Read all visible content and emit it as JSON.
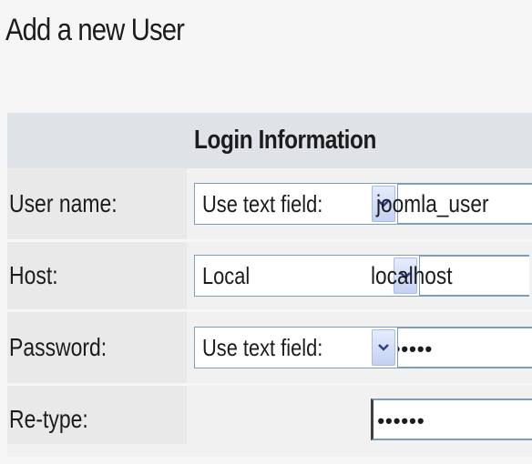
{
  "header": {
    "title": "Add a new User"
  },
  "login_info": {
    "legend": "Login Information",
    "rows": [
      {
        "label": "User name:",
        "type_select": "Use text field:",
        "value": "joomla_user"
      },
      {
        "label": "Host:",
        "type_select": "Local",
        "value": "localhost"
      },
      {
        "label": "Password:",
        "type_select": "Use text field:",
        "value": "•••••••"
      },
      {
        "label": "Re-type:",
        "type_select": "",
        "value": "••••••"
      }
    ]
  },
  "icons": {
    "dropdown": "chevron-down-icon"
  },
  "colors": {
    "legend_bg": "#dfe3e8",
    "label_bg": "#e9e9e9",
    "input_border": "#7f9db9",
    "dropdown_button": "#c4d1f3"
  }
}
